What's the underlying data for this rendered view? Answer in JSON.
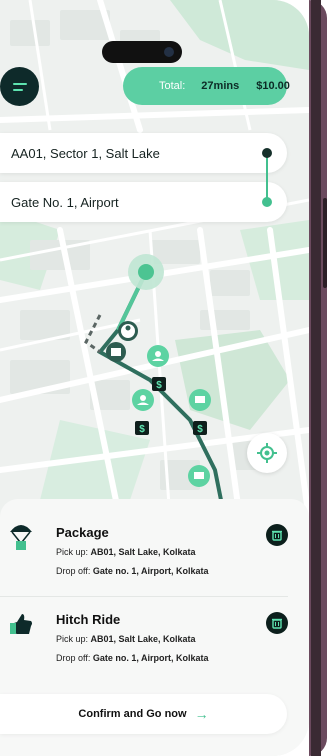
{
  "header": {
    "total_label": "Total:",
    "total_time": "27mins",
    "total_price": "$10.00"
  },
  "route": {
    "pickup": "AA01, Sector 1, Salt Lake",
    "dropoff": "Gate No. 1, Airport"
  },
  "map": {
    "markers": [
      "$",
      "$",
      "$"
    ]
  },
  "items": [
    {
      "title": "Package",
      "pickup_label": "Pick up: ",
      "pickup_value": "AB01, Salt Lake, Kolkata",
      "dropoff_label": "Drop off: ",
      "dropoff_value": "Gate no. 1, Airport, Kolkata",
      "icon": "parachute-package-icon"
    },
    {
      "title": "Hitch Ride",
      "pickup_label": "Pick up: ",
      "pickup_value": "AB01, Salt Lake, Kolkata",
      "dropoff_label": "Drop off: ",
      "dropoff_value": "Gate no. 1, Airport, Kolkata",
      "icon": "thumbs-up-icon"
    }
  ],
  "actions": {
    "confirm_label": "Confirm and Go now",
    "confirm_arrow": "→"
  },
  "colors": {
    "accent": "#43c08f",
    "total_pill": "#5ccfa3",
    "dark": "#0e2a2a"
  }
}
